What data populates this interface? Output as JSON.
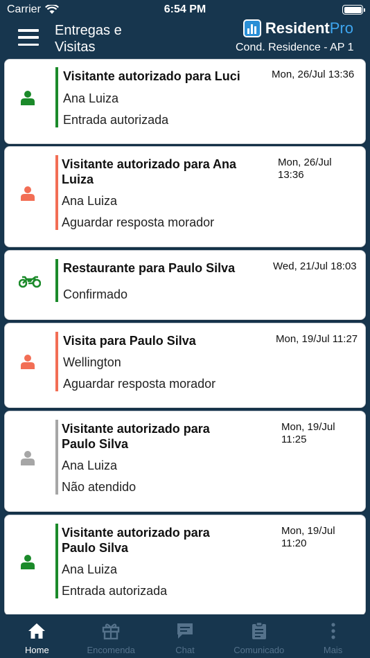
{
  "status_bar": {
    "carrier": "Carrier",
    "time": "6:54 PM"
  },
  "header": {
    "title": "Entregas e Visitas",
    "brand_main": "Resident",
    "brand_accent": "Pro",
    "condo": "Cond. Residence - AP 1"
  },
  "colors": {
    "background": "#17364e",
    "authorized": "#1b8a2a",
    "pending": "#f26e55",
    "unanswered": "#a6a6a6"
  },
  "cards": [
    {
      "icon": "person-icon",
      "status": "authorized",
      "title": "Visitante autorizado para Luci",
      "date": "Mon, 26/Jul 13:36",
      "line1": "Ana Luiza",
      "line2": "Entrada autorizada"
    },
    {
      "icon": "person-icon",
      "status": "pending",
      "title": "Visitante autorizado para Ana Luiza",
      "date": "Mon, 26/Jul 13:36",
      "line1": "Ana Luiza",
      "line2": "Aguardar resposta morador"
    },
    {
      "icon": "motorcycle-icon",
      "status": "authorized",
      "title": "Restaurante para Paulo Silva",
      "date": "Wed, 21/Jul 18:03",
      "line1": "Confirmado",
      "line2": ""
    },
    {
      "icon": "person-icon",
      "status": "pending",
      "title": "Visita para Paulo Silva",
      "date": "Mon, 19/Jul 11:27",
      "line1": "Wellington",
      "line2": "Aguardar resposta morador"
    },
    {
      "icon": "person-icon",
      "status": "unanswered",
      "title": "Visitante autorizado para Paulo Silva",
      "date": "Mon, 19/Jul 11:25",
      "line1": "Ana Luiza",
      "line2": "Não atendido"
    },
    {
      "icon": "person-icon",
      "status": "authorized",
      "title": "Visitante autorizado para Paulo Silva",
      "date": "Mon, 19/Jul 11:20",
      "line1": "Ana Luiza",
      "line2": "Entrada autorizada"
    }
  ],
  "tabs": [
    {
      "label": "Home",
      "icon": "home-icon",
      "active": true
    },
    {
      "label": "Encomenda",
      "icon": "gift-icon",
      "active": false
    },
    {
      "label": "Chat",
      "icon": "chat-icon",
      "active": false
    },
    {
      "label": "Comunicado",
      "icon": "clipboard-icon",
      "active": false
    },
    {
      "label": "Mais",
      "icon": "more-icon",
      "active": false
    }
  ]
}
